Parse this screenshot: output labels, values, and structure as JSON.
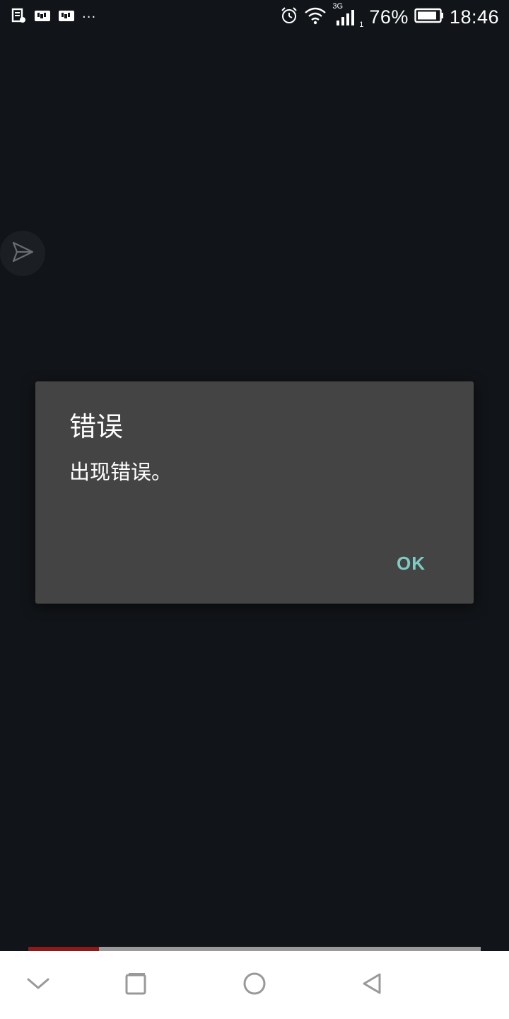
{
  "status_bar": {
    "left_icons": [
      "notification-doc-icon",
      "notification-app-icon",
      "notification-app-icon",
      "more-dots-icon"
    ],
    "more_dots": "···",
    "network_label": "3G",
    "sim_index": "1",
    "battery_percent": "76%",
    "time": "18:46"
  },
  "floating_button": {
    "icon": "send-icon"
  },
  "dialog": {
    "title": "错误",
    "message": "出现错误。",
    "ok_label": "OK",
    "accent_color": "#7fcbc4"
  },
  "nav_bar": {
    "buttons": [
      "chevron-down-icon",
      "recent-apps-icon",
      "home-icon",
      "back-icon"
    ]
  },
  "colors": {
    "background": "#111418",
    "dialog_bg": "#444444",
    "nav_bg": "#ffffff",
    "nav_icon": "#999999"
  }
}
